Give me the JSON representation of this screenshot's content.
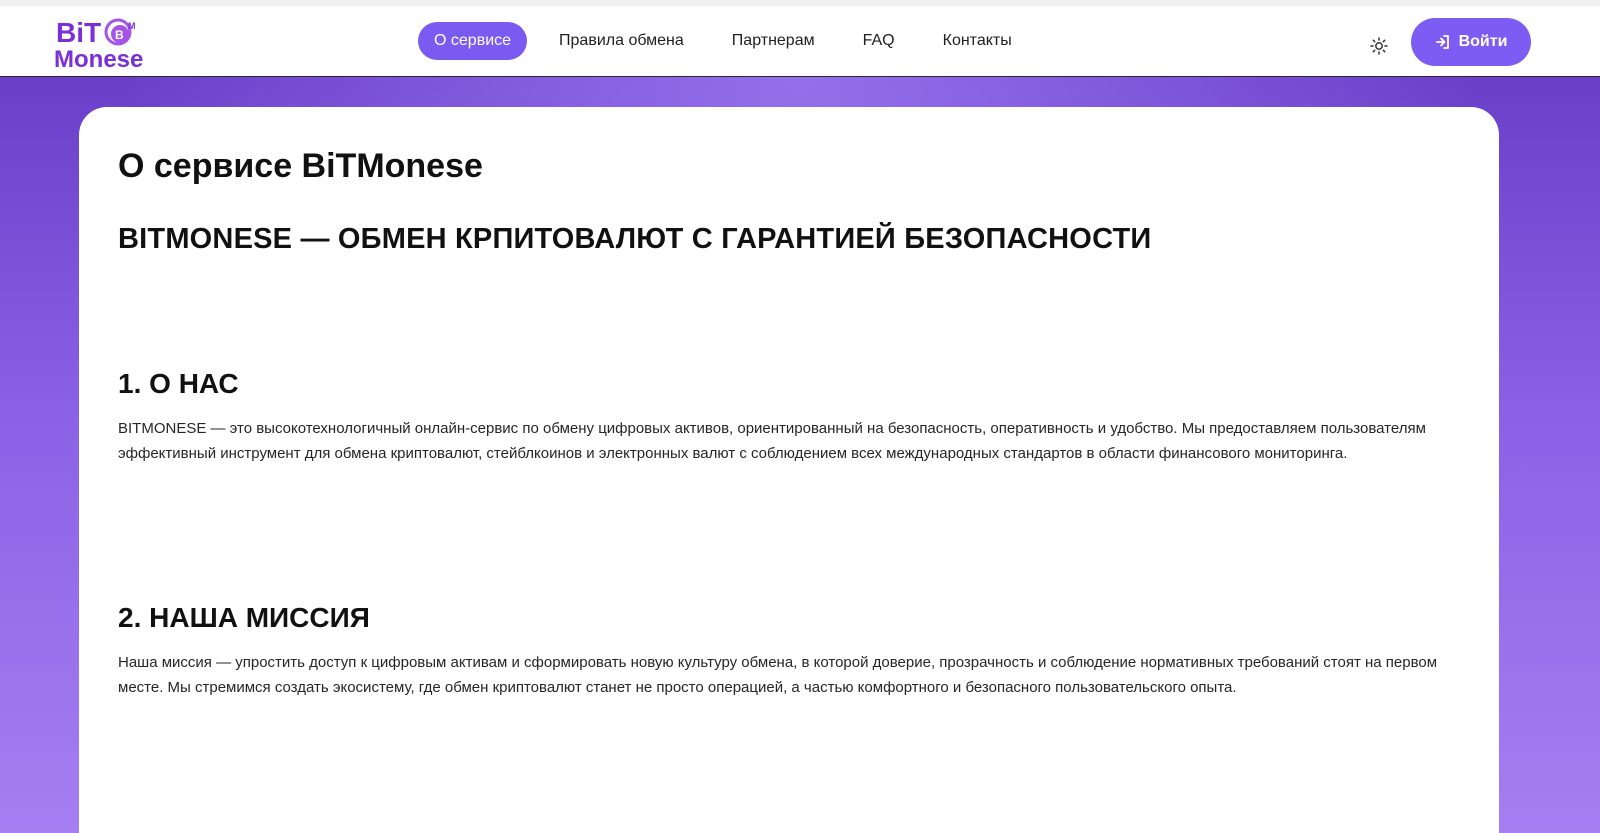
{
  "header": {
    "logo": {
      "line1": "BiT",
      "line2": "Monese",
      "coin_letter": "B",
      "coin_letter2": "M"
    },
    "nav": [
      {
        "label": "О сервисе",
        "active": true
      },
      {
        "label": "Правила обмена",
        "active": false
      },
      {
        "label": "Партнерам",
        "active": false
      },
      {
        "label": "FAQ",
        "active": false
      },
      {
        "label": "Контакты",
        "active": false
      }
    ],
    "theme_icon": "sun-icon",
    "login_label": "Войти",
    "login_icon": "login-arrow-icon"
  },
  "content": {
    "page_title": "О сервисе BiTMonese",
    "main_heading": "BITMONESE — ОБМЕН КРПИТОВАЛЮТ С ГАРАНТИЕЙ БЕЗОПАСНОСТИ",
    "sections": [
      {
        "heading": "1. О НАС",
        "text": "BITMONESE — это высокотехнологичный онлайн-сервис по обмену цифровых активов, ориентированный на безопасность, оперативность и удобство. Мы предоставляем пользователям эффективный инструмент для обмена криптовалют, стейблкоинов и электронных валют с соблюдением всех международных стандартов в области финансового мониторинга."
      },
      {
        "heading": "2. НАША МИССИЯ",
        "text": "Наша миссия — упростить доступ к цифровым активам и сформировать новую культуру обмена, в которой доверие, прозрачность и соблюдение нормативных требований стоят на первом месте. Мы стремимся создать экосистему, где обмен криптовалют станет не просто операцией, а частью комфортного и безопасного пользовательского опыта."
      }
    ]
  },
  "colors": {
    "accent": "#7d5cf4",
    "logo_purple": "#7b2fd6",
    "background_top": "#6a3fc9",
    "background_bottom": "#a57ff0"
  }
}
